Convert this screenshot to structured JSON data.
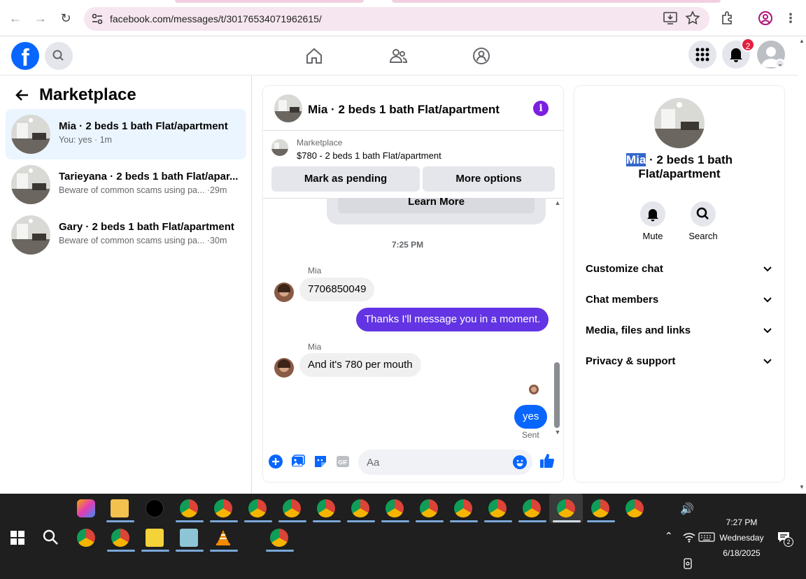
{
  "browser": {
    "url": "facebook.com/messages/t/30176534071962615/"
  },
  "header": {
    "notification_count": "2"
  },
  "sidebar": {
    "title": "Marketplace",
    "conversations": [
      {
        "name": "Mia · 2 beds 1 bath Flat/apartment",
        "snippet": "You: yes · 1m",
        "active": true
      },
      {
        "name": "Tarieyana · 2 beds 1 bath Flat/apar...",
        "snippet": "Beware of common scams using pa... ·29m",
        "active": false
      },
      {
        "name": "Gary · 2 beds 1 bath Flat/apartment",
        "snippet": "Beware of common scams using pa... ·30m",
        "active": false
      }
    ]
  },
  "chat": {
    "title": "Mia · 2 beds 1 bath Flat/apartment",
    "marketplace_label": "Marketplace",
    "listing": "$780 - 2 beds 1 bath Flat/apartment",
    "pending_button": "Mark as pending",
    "more_button": "More options",
    "learn_more": "Learn More",
    "timestamp": "7:25 PM",
    "messages": [
      {
        "sender": "Mia",
        "text": "7706850049",
        "direction": "in"
      },
      {
        "text": "Thanks I'll message you in a moment.",
        "direction": "out",
        "color": "#6334e3"
      },
      {
        "sender": "Mia",
        "text": "And it's 780 per mouth",
        "direction": "in"
      },
      {
        "text": "yes",
        "direction": "out",
        "color": "#0866ff"
      }
    ],
    "sent_status": "Sent",
    "composer_placeholder": "Aa"
  },
  "details": {
    "name_highlight": "Mia",
    "name_rest": " · 2 beds 1 bath Flat/apartment",
    "actions": [
      {
        "label": "Mute",
        "icon": "bell-icon"
      },
      {
        "label": "Search",
        "icon": "search-icon"
      }
    ],
    "sections": [
      "Customize chat",
      "Chat members",
      "Media, files and links",
      "Privacy & support"
    ]
  },
  "taskbar": {
    "time": "7:27 PM",
    "day": "Wednesday",
    "date": "6/18/2025",
    "notif_count": "2"
  },
  "colors": {
    "fb_blue": "#0866ff",
    "accent_purple": "#7b1fe0",
    "active_row": "#ebf5ff"
  }
}
